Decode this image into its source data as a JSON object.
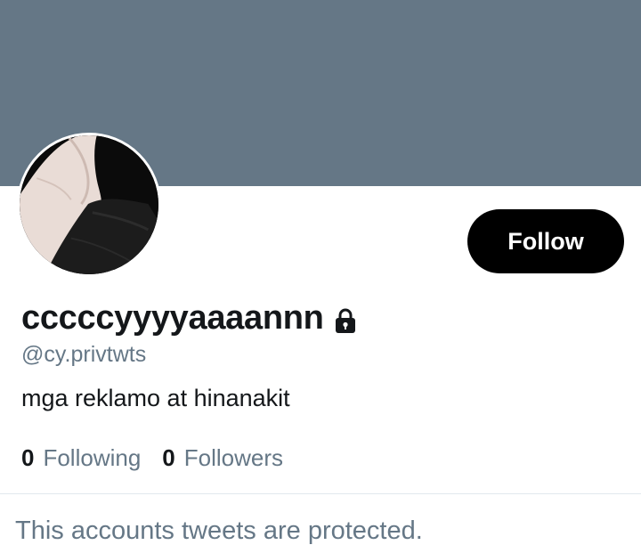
{
  "profile": {
    "display_name": "cccccyyyyaaaannn",
    "handle": "@cy.privtwts",
    "bio": "mga reklamo at hinanakit",
    "protected": true,
    "banner_color": "#657786"
  },
  "actions": {
    "follow_label": "Follow"
  },
  "stats": {
    "following_count": "0",
    "following_label": "Following",
    "followers_count": "0",
    "followers_label": "Followers"
  },
  "timeline": {
    "protected_message": "This accounts tweets are protected."
  },
  "icons": {
    "lock": "lock-icon"
  }
}
